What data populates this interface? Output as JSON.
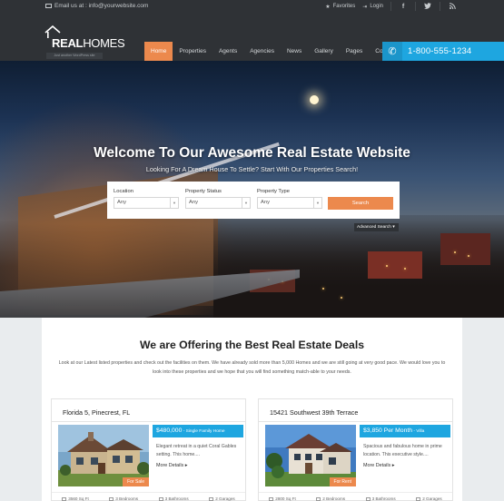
{
  "topbar": {
    "email": "Email us at : info@yourwebsite.com",
    "favorites": "Favorites",
    "login": "Login",
    "social_icons": [
      "facebook-icon",
      "twitter-icon",
      "rss-icon"
    ]
  },
  "logo": {
    "brand_bold": "REAL",
    "brand_light": "HOMES",
    "tagline": "Just another WordPress site"
  },
  "nav": {
    "items": [
      "Home",
      "Properties",
      "Agents",
      "Agencies",
      "News",
      "Gallery",
      "Pages",
      "Contact"
    ],
    "active": "Home"
  },
  "phone": {
    "number": "1-800-555-1234"
  },
  "hero": {
    "title": "Welcome To Our Awesome Real Estate Website",
    "subtitle": "Looking For A Dream House To Settle? Start With Our Properties Search!"
  },
  "search": {
    "location_label": "Location",
    "location_value": "Any",
    "status_label": "Property Status",
    "status_value": "Any",
    "type_label": "Property Type",
    "type_value": "Any",
    "button": "Search",
    "advanced": "Advanced Search"
  },
  "offer": {
    "title": "We are Offering the Best Real Estate Deals",
    "text": "Look at our Latest listed properties and check out the facilities on them. We have already sold more than 5,000 Homes and we are still going at very good pace. We would love you to look into these properties and we hope that you will find something match-able to your needs."
  },
  "cards": [
    {
      "title": "Florida 5, Pinecrest, FL",
      "price": "$480,000",
      "type": " - Single Family Home",
      "desc": "Elegant retreat in a quiet Coral Gables setting. This home....",
      "more": "More Details",
      "status": "For Sale",
      "meta": [
        "3560 Sq Ft",
        "3 Bedrooms",
        "3 Bathrooms",
        "2 Garages"
      ]
    },
    {
      "title": "15421 Southwest 39th Terrace",
      "price": "$3,850 Per Month",
      "type": " - Villa",
      "desc": "Spacious and fabulous home in prime location. This executive style....",
      "more": "More Details",
      "status": "For Rent",
      "meta": [
        "2800 Sq Ft",
        "2 Bedrooms",
        "3 Bathrooms",
        "2 Garages"
      ]
    }
  ],
  "colors": {
    "accent_orange": "#ec894d",
    "accent_blue": "#1ea6e0",
    "header_dark": "#2f3236"
  }
}
